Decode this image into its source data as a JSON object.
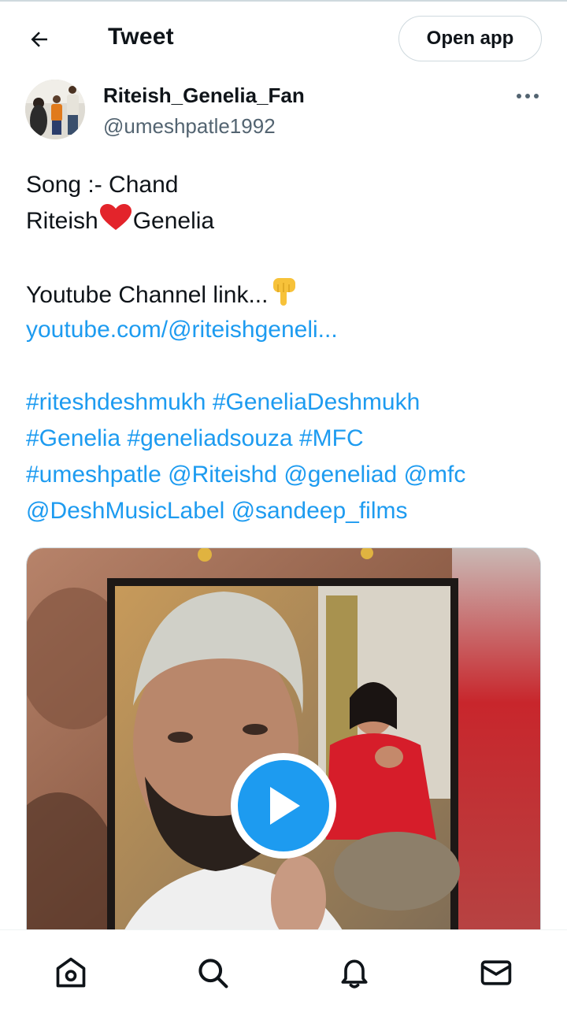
{
  "header": {
    "title": "Tweet",
    "open_app_label": "Open app"
  },
  "author": {
    "name": "Riteish_Genelia_Fan",
    "handle": "@umeshpatle1992"
  },
  "tweet": {
    "song_line": "Song :- Chand",
    "name_left": "Riteish",
    "name_right": "Genelia",
    "channel_line": "Youtube Channel link...",
    "channel_url": "youtube.com/@riteishgeneli...",
    "tag_line_1": [
      "#riteshdeshmukh",
      "#GeneliaDeshmukh"
    ],
    "tag_line_2": [
      "#Genelia",
      "#geneliadsouza",
      "#MFC"
    ],
    "tag_line_3": [
      "#umeshpatle",
      "@Riteishd",
      "@geneliad",
      "@mfc"
    ],
    "tag_line_4": [
      "@DeshMusicLabel",
      "@sandeep_films"
    ]
  },
  "icons": {
    "back": "arrow-left-icon",
    "more": "more-horizontal-icon",
    "play": "play-icon",
    "home": "home-icon",
    "search": "search-icon",
    "notifications": "bell-icon",
    "messages": "envelope-icon",
    "heart": "red-heart-emoji",
    "point": "pointing-down-emoji"
  },
  "colors": {
    "accent": "#1d9bf0",
    "text": "#0f1419",
    "muted": "#536471",
    "border": "#cfd9de"
  }
}
